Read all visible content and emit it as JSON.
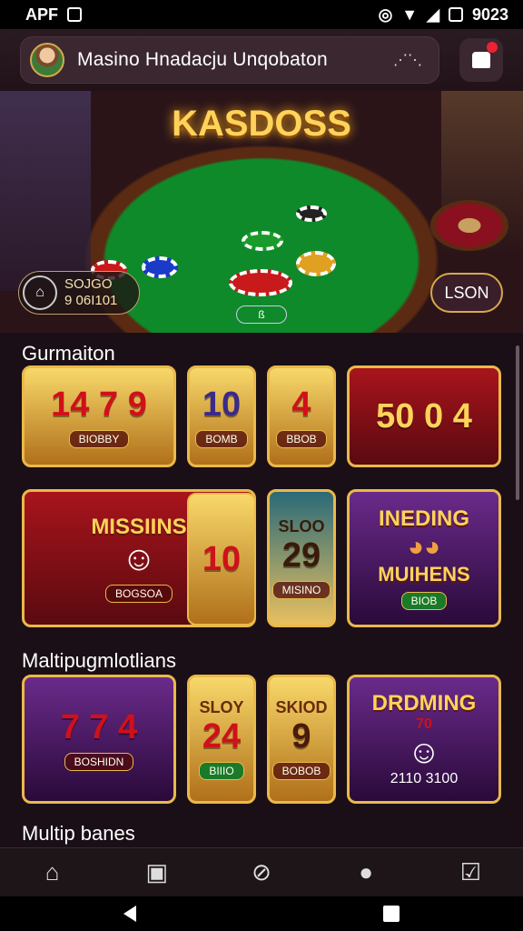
{
  "status_bar": {
    "left_text": "APF",
    "time": "9023"
  },
  "header": {
    "title": "Masino Hnadacju Unqobaton",
    "icon": "dots-trend-icon",
    "notification_badge": ""
  },
  "hero": {
    "title": "KASDOSS",
    "left_pill": {
      "line1": "SOJGO",
      "line2": "9 06I101"
    },
    "button_label": "LSON",
    "ring_text": "ß"
  },
  "sections": [
    {
      "title": "Gurmaiton"
    },
    {
      "title": "Maltipugmlotlians"
    },
    {
      "title": "Multip banes"
    }
  ],
  "tiles": {
    "row1": [
      {
        "nums": "14 7 9",
        "label": "BIOBBY"
      },
      {
        "num": "10",
        "label": "BOMB"
      },
      {
        "num": "4",
        "label": "BBOB"
      },
      {
        "nums": "50 0 4"
      }
    ],
    "row2": [
      {
        "title": "MISSIINS",
        "label": "BOGSOA"
      },
      {
        "num": "10"
      },
      {
        "title": "SLOO",
        "num": "29",
        "label": "MISINO"
      },
      {
        "title": "INEDING",
        "sub": "MUIHENS",
        "label": "BIOB"
      }
    ],
    "row3": [
      {
        "nums": "7 7 4",
        "label": "BOSHIDN"
      },
      {
        "title": "SLOY",
        "num": "24",
        "label": "BIIIO"
      },
      {
        "title": "SKIOD",
        "num": "9",
        "label": "BOBOB"
      },
      {
        "title": "DRDMING",
        "label": "2110 3100",
        "badge": "70"
      }
    ]
  },
  "bottom_nav": [
    "home-icon",
    "image-icon",
    "compass-icon",
    "profile-icon",
    "chat-icon"
  ]
}
